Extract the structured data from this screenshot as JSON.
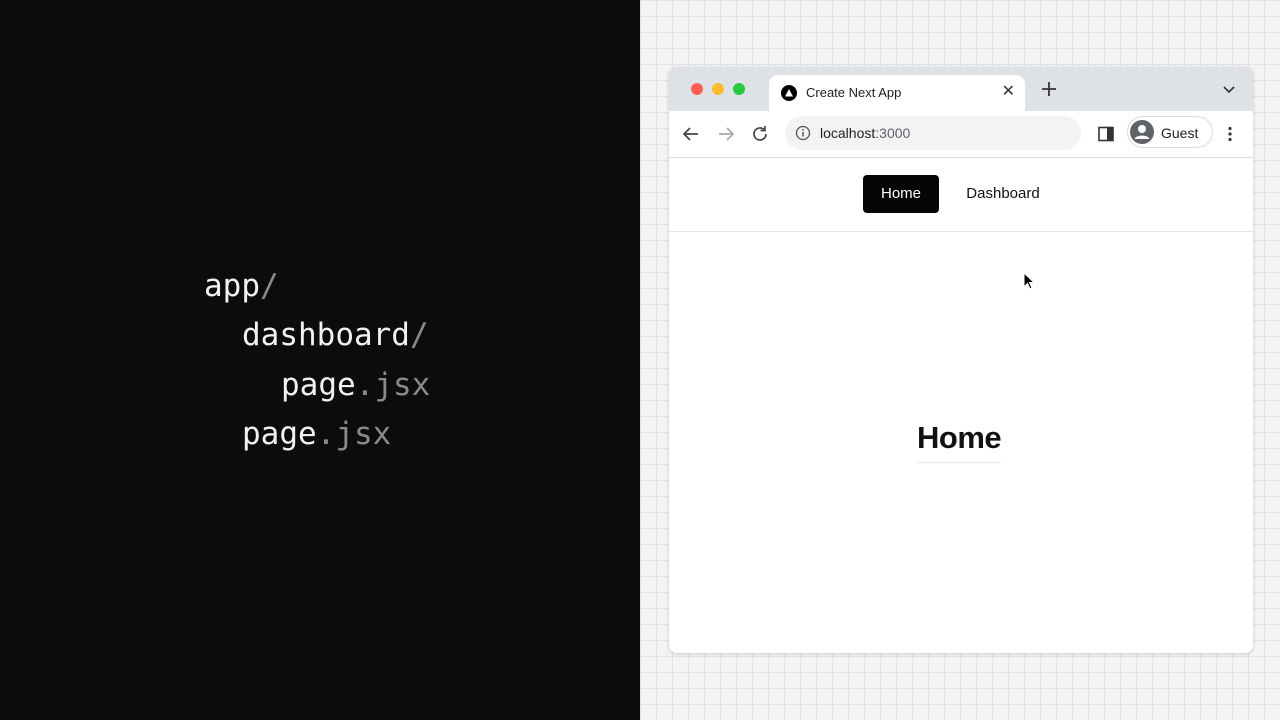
{
  "file_tree": {
    "app_name": "app",
    "dashboard_name": "dashboard",
    "slash": "/",
    "page_name": "page",
    "ext_dot": ".",
    "ext": "jsx"
  },
  "browser": {
    "tab": {
      "title": "Create Next App",
      "close": "✕",
      "icon": "nextjs-logo-icon"
    },
    "address": {
      "host": "localhost",
      "port": ":3000"
    },
    "profile": {
      "name": "Guest"
    },
    "traffic_colors": {
      "close": "#ff5f57",
      "minimize": "#febc2e",
      "maximize": "#28c840"
    }
  },
  "page": {
    "nav": [
      {
        "label": "Home",
        "active": true
      },
      {
        "label": "Dashboard",
        "active": false
      }
    ],
    "heading": "Home"
  },
  "colors": {
    "left_bg": "#0c0c0f",
    "active_nav_bg": "#050505"
  }
}
